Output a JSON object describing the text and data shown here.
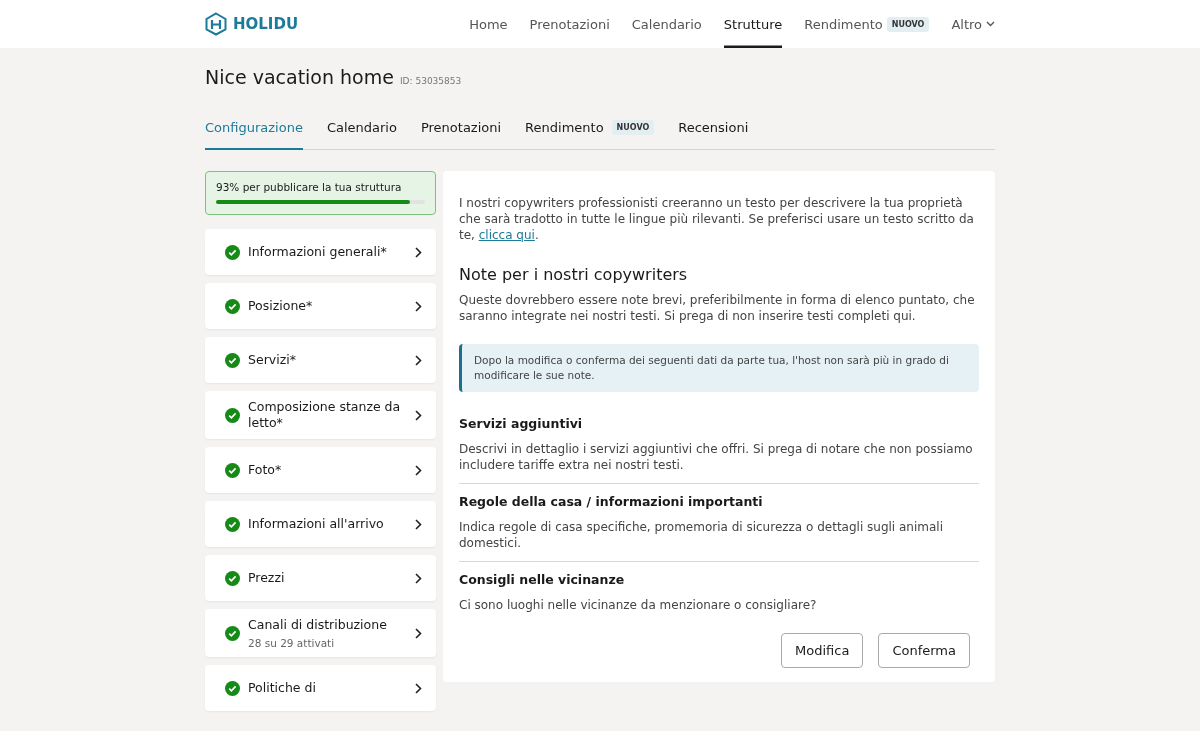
{
  "topnav": {
    "logo": "HOLIDU",
    "items": [
      {
        "label": "Home",
        "selected": false
      },
      {
        "label": "Prenotazioni",
        "selected": false
      },
      {
        "label": "Calendario",
        "selected": false
      },
      {
        "label": "Strutture",
        "selected": true
      },
      {
        "label": "Rendimento",
        "selected": false,
        "badge": "NUOVO"
      },
      {
        "label": "Altro",
        "selected": false,
        "dropdown": true
      }
    ]
  },
  "property": {
    "title": "Nice vacation home",
    "id": "ID: 53035853"
  },
  "tabs": [
    {
      "label": "Configurazione",
      "selected": true
    },
    {
      "label": "Calendario",
      "selected": false
    },
    {
      "label": "Prenotazioni",
      "selected": false
    },
    {
      "label": "Rendimento",
      "selected": false,
      "badge": "NUOVO"
    },
    {
      "label": "Recensioni",
      "selected": false
    }
  ],
  "progress": {
    "label": "93% per pubblicare la tua struttura",
    "level": 0.93
  },
  "sidebar": {
    "items": [
      {
        "label": "Informazioni generali*",
        "completed": true
      },
      {
        "label": "Posizione*",
        "completed": true
      },
      {
        "label": "Servizi*",
        "completed": true
      },
      {
        "label": "Composizione stanze da letto*",
        "completed": true
      },
      {
        "label": "Foto*",
        "completed": true
      },
      {
        "label": "Informazioni all'arrivo",
        "completed": true
      },
      {
        "label": "Prezzi",
        "completed": true
      },
      {
        "label": "Canali di distribuzione",
        "completed": true,
        "subtitle": "28 su 29 attivati"
      },
      {
        "label": "Politiche di",
        "completed": true
      }
    ]
  },
  "panel": {
    "intro": {
      "text": "I nostri copywriters professionisti creeranno un testo per descrivere la tua proprietà che sarà tradotto in tutte le lingue più rilevanti. Se preferisci usare un testo scritto da te, ",
      "link": "clicca qui",
      "tail": "."
    },
    "heading": "Note per i nostri copywriters",
    "description": "Queste dovrebbero essere note brevi, preferibilmente in forma di elenco puntato, che saranno integrate nei nostri testi. Si prega di non inserire testi completi qui.",
    "notice": "Dopo la modifica o conferma dei seguenti dati da parte tua, l'host non sarà più in grado di modificare le sue note.",
    "sections": [
      {
        "title": "Servizi aggiuntivi",
        "text": "Descrivi in dettaglio i servizi aggiuntivi che offri. Si prega di notare che non possiamo includere tariffe extra nei nostri testi."
      },
      {
        "title": "Regole della casa / informazioni importanti",
        "text": "Indica regole di casa specifiche, promemoria di sicurezza o dettagli sugli animali domestici."
      },
      {
        "title": "Consigli nelle vicinanze",
        "text": "Ci sono luoghi nelle vicinanze da menzionare o consigliare?"
      }
    ],
    "buttons": [
      "Modifica",
      "Conferma"
    ]
  }
}
